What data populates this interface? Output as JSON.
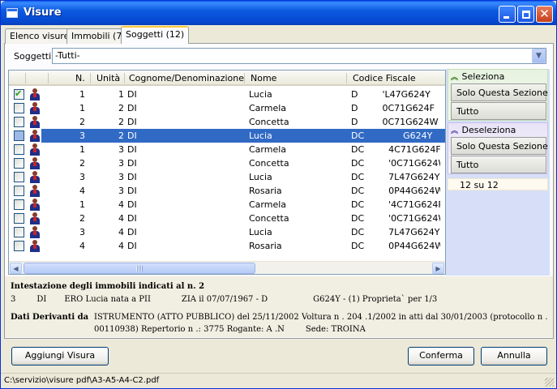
{
  "window": {
    "title": "Visure"
  },
  "tabs": [
    {
      "label": "Elenco visure"
    },
    {
      "label": "Immobili (7)"
    },
    {
      "label": "Soggetti (12)"
    }
  ],
  "filter": {
    "label": "Soggetti:",
    "value": "-Tutti-"
  },
  "grid": {
    "columns": [
      "N.",
      "Unità",
      "Cognome/Denominazione",
      "Nome",
      "Codice Fiscale"
    ],
    "rows": [
      {
        "checked": true,
        "n": "1",
        "unita": "1",
        "cognome": "DI",
        "nome": "Lucia",
        "cf_prefix": "D",
        "cf_suffix": "'L47G624Y"
      },
      {
        "checked": false,
        "n": "1",
        "unita": "2",
        "cognome": "DI",
        "nome": "Carmela",
        "cf_prefix": "D",
        "cf_suffix": "0C71G624F"
      },
      {
        "checked": false,
        "n": "2",
        "unita": "2",
        "cognome": "DI",
        "nome": "Concetta",
        "cf_prefix": "D",
        "cf_suffix": "0C71G624W"
      },
      {
        "checked": false,
        "n": "3",
        "unita": "2",
        "cognome": "DI",
        "nome": "Lucia",
        "cf_prefix": "DC",
        "cf_suffix": "G624Y",
        "selected": true
      },
      {
        "checked": false,
        "n": "1",
        "unita": "3",
        "cognome": "DI",
        "nome": "Carmela",
        "cf_prefix": "DC",
        "cf_suffix": "4C71G624F"
      },
      {
        "checked": false,
        "n": "2",
        "unita": "3",
        "cognome": "DI",
        "nome": "Concetta",
        "cf_prefix": "DC",
        "cf_suffix": "'0C71G624W"
      },
      {
        "checked": false,
        "n": "3",
        "unita": "3",
        "cognome": "DI",
        "nome": "Lucia",
        "cf_prefix": "DC",
        "cf_suffix": "7L47G624Y"
      },
      {
        "checked": false,
        "n": "4",
        "unita": "3",
        "cognome": "DI",
        "nome": "Rosaria",
        "cf_prefix": "DC",
        "cf_suffix": "0P44G624W"
      },
      {
        "checked": false,
        "n": "1",
        "unita": "4",
        "cognome": "DI",
        "nome": "Carmela",
        "cf_prefix": "DC",
        "cf_suffix": "'4C71G624F"
      },
      {
        "checked": false,
        "n": "2",
        "unita": "4",
        "cognome": "DI",
        "nome": "Concetta",
        "cf_prefix": "DC",
        "cf_suffix": "'0C71G624W"
      },
      {
        "checked": false,
        "n": "3",
        "unita": "4",
        "cognome": "DI",
        "nome": "Lucia",
        "cf_prefix": "DC",
        "cf_suffix": "7L47G624Y"
      },
      {
        "checked": false,
        "n": "4",
        "unita": "4",
        "cognome": "DI",
        "nome": "Rosaria",
        "cf_prefix": "DC",
        "cf_suffix": "0P44G624W"
      }
    ]
  },
  "side": {
    "seleziona": {
      "label": "Seleziona",
      "btn_section": "Solo Questa Sezione",
      "btn_all": "Tutto"
    },
    "deseleziona": {
      "label": "Deseleziona",
      "btn_section": "Solo Questa Sezione",
      "btn_all": "Tutto"
    },
    "count": "12 su 12"
  },
  "info": {
    "title": "Intestazione degli immobili indicati al n. 2",
    "line1_a": "3",
    "line1_b": "DI",
    "line1_c": "ERO Lucia nata a PII",
    "line1_d": "ZIA il 07/07/1967 - D",
    "line1_e": "G624Y - (1) Proprieta` per 1/3",
    "label2": "Dati Derivanti da",
    "line2": "ISTRUMENTO (ATTO PUBBLICO) del 25/11/2002 Voltura n . 204 .1/2002 in atti dal 30/01/2003 (protocollo n .",
    "line3_a": "00110938) Repertorio n .: 3775 Rogante: A .N",
    "line3_b": "Sede: TROINA"
  },
  "buttons": {
    "add": "Aggiungi Visura",
    "confirm": "Conferma",
    "cancel": "Annulla"
  },
  "status": {
    "path": "C:\\servizio\\visure pdf\\A3-A5-A4-C2.pdf"
  }
}
